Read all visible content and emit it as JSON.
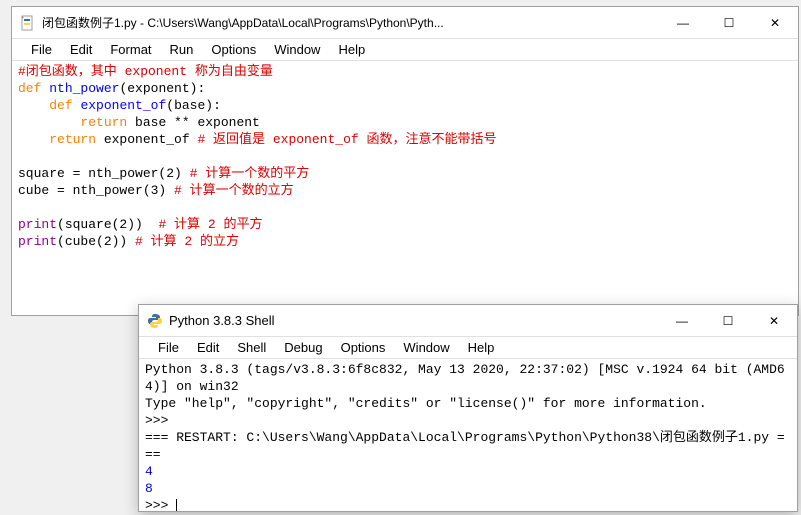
{
  "editor_window": {
    "title": "闭包函数例子1.py - C:\\Users\\Wang\\AppData\\Local\\Programs\\Python\\Pyth...",
    "menus": [
      "File",
      "Edit",
      "Format",
      "Run",
      "Options",
      "Window",
      "Help"
    ],
    "code": {
      "l1_comment": "#闭包函数，其中 exponent 称为自由变量",
      "l2_def": "def",
      "l2_name": "nth_power",
      "l2_params": "(exponent):",
      "l3_def": "def",
      "l3_name": "exponent_of",
      "l3_params": "(base):",
      "l4_return": "return",
      "l4_expr": " base ** exponent",
      "l5_return": "return",
      "l5_expr": " exponent_of ",
      "l5_comment": "# 返回值是 exponent_of 函数，注意不能带括号",
      "l7_lhs": "square = nth_power(2) ",
      "l7_comment": "# 计算一个数的平方",
      "l8_lhs": "cube = nth_power(3) ",
      "l8_comment": "# 计算一个数的立方",
      "l10_print": "print",
      "l10_args": "(square(2))  ",
      "l10_comment": "# 计算 2 的平方",
      "l11_print": "print",
      "l11_args": "(cube(2)) ",
      "l11_comment": "# 计算 2 的立方"
    }
  },
  "shell_window": {
    "title": "Python 3.8.3 Shell",
    "menus": [
      "File",
      "Edit",
      "Shell",
      "Debug",
      "Options",
      "Window",
      "Help"
    ],
    "banner1": "Python 3.8.3 (tags/v3.8.3:6f8c832, May 13 2020, 22:37:02) [MSC v.1924 64 bit (AMD64)] on win32",
    "banner2": "Type \"help\", \"copyright\", \"credits\" or \"license()\" for more information.",
    "prompt": ">>>",
    "restart": "=== RESTART: C:\\Users\\Wang\\AppData\\Local\\Programs\\Python\\Python38\\闭包函数例子1.py ===",
    "out1": "4",
    "out2": "8"
  },
  "window_controls": {
    "min": "—",
    "max": "☐",
    "close": "✕"
  }
}
